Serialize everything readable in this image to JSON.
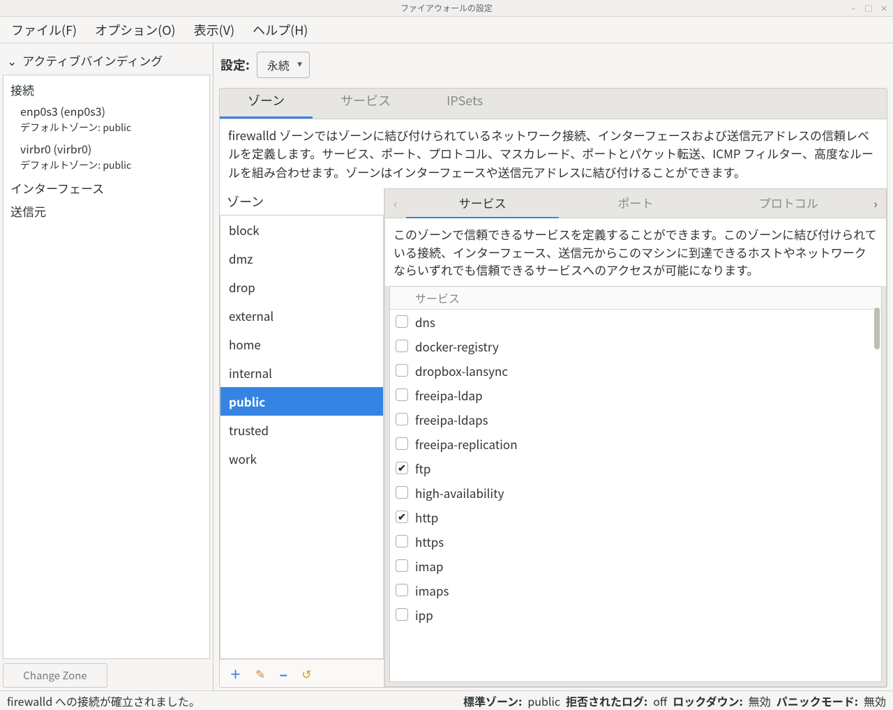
{
  "window": {
    "title": "ファイアウォールの設定"
  },
  "menubar": {
    "file": "ファイル(F)",
    "options": "オプション(O)",
    "view": "表示(V)",
    "help": "ヘルプ(H)"
  },
  "left": {
    "expander": "アクティブバインディング",
    "headers": {
      "connections": "接続",
      "interfaces": "インターフェース",
      "sources": "送信元"
    },
    "connections": [
      {
        "name": "enp0s3 (enp0s3)",
        "sub": "デフォルトゾーン: public"
      },
      {
        "name": "virbr0 (virbr0)",
        "sub": "デフォルトゾーン: public"
      }
    ],
    "change_zone": "Change Zone"
  },
  "config": {
    "label": "設定:",
    "value": "永続"
  },
  "tabs": {
    "zones": "ゾーン",
    "services": "サービス",
    "ipsets": "IPSets"
  },
  "zone_description": "firewalld ゾーンではゾーンに結び付けられているネットワーク接続、インターフェースおよび送信元アドレスの信頼レベルを定義します。サービス、ポート、プロトコル、マスカレード、ポートとパケット転送、ICMP フィルター、高度なルールを組み合わせます。ゾーンはインターフェースや送信元アドレスに結び付けることができます。",
  "zone_list": {
    "title": "ゾーン",
    "items": [
      "block",
      "dmz",
      "drop",
      "external",
      "home",
      "internal",
      "public",
      "trusted",
      "work"
    ],
    "selected": "public"
  },
  "inner_tabs": {
    "services": "サービス",
    "ports": "ポート",
    "protocols": "プロトコル"
  },
  "service_desc": "このゾーンで信頼できるサービスを定義することができます。このゾーンに結び付けられている接続、インターフェース、送信元からこのマシンに到達できるホストやネットワークならいずれでも信頼できるサービスへのアクセスが可能になります。",
  "service_table": {
    "header": "サービス",
    "rows": [
      {
        "name": "dns",
        "checked": false
      },
      {
        "name": "docker-registry",
        "checked": false
      },
      {
        "name": "dropbox-lansync",
        "checked": false
      },
      {
        "name": "freeipa-ldap",
        "checked": false
      },
      {
        "name": "freeipa-ldaps",
        "checked": false
      },
      {
        "name": "freeipa-replication",
        "checked": false
      },
      {
        "name": "ftp",
        "checked": true
      },
      {
        "name": "high-availability",
        "checked": false
      },
      {
        "name": "http",
        "checked": true
      },
      {
        "name": "https",
        "checked": false
      },
      {
        "name": "imap",
        "checked": false
      },
      {
        "name": "imaps",
        "checked": false
      },
      {
        "name": "ipp",
        "checked": false
      }
    ]
  },
  "status": {
    "left": "firewalld への接続が確立されました。",
    "default_zone_label": "標準ゾーン:",
    "default_zone": "public",
    "denied_log_label": "拒否されたログ:",
    "denied_log": "off",
    "lockdown_label": "ロックダウン:",
    "lockdown": "無効",
    "panic_label": "パニックモード:",
    "panic": "無効"
  },
  "icons": {
    "add": "＋",
    "edit": "✎",
    "remove": "–",
    "reload": "↺",
    "chevron_left": "‹",
    "chevron_right": "›",
    "chevron_down": "⌄"
  }
}
